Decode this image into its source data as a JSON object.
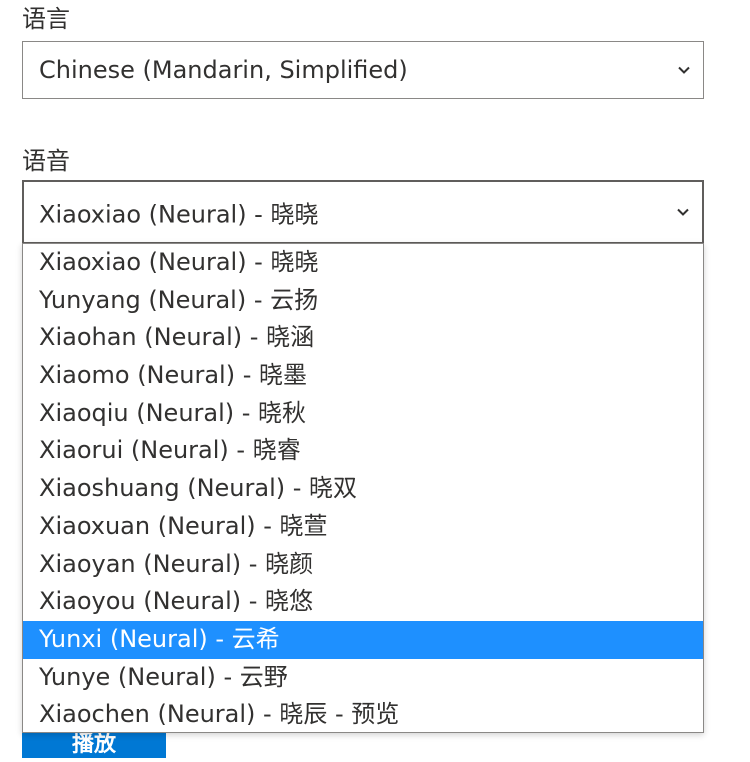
{
  "language": {
    "label": "语言",
    "selected": "Chinese (Mandarin, Simplified)"
  },
  "voice": {
    "label": "语音",
    "selected": "Xiaoxiao (Neural) - 晓晓",
    "options": [
      "Xiaoxiao (Neural) - 晓晓",
      "Yunyang (Neural) - 云扬",
      "Xiaohan (Neural) - 晓涵",
      "Xiaomo (Neural) - 晓墨",
      "Xiaoqiu (Neural) - 晓秋",
      "Xiaorui (Neural) - 晓睿",
      "Xiaoshuang (Neural) - 晓双",
      "Xiaoxuan (Neural) - 晓萱",
      "Xiaoyan (Neural) - 晓颜",
      "Xiaoyou (Neural) - 晓悠",
      "Yunxi (Neural) - 云希",
      "Yunye (Neural) - 云野",
      "Xiaochen (Neural) - 晓辰 - 预览"
    ],
    "highlighted_index": 10
  },
  "play_button": {
    "label": "播放"
  },
  "colors": {
    "highlight": "#1e90ff",
    "accent": "#0078d4"
  }
}
